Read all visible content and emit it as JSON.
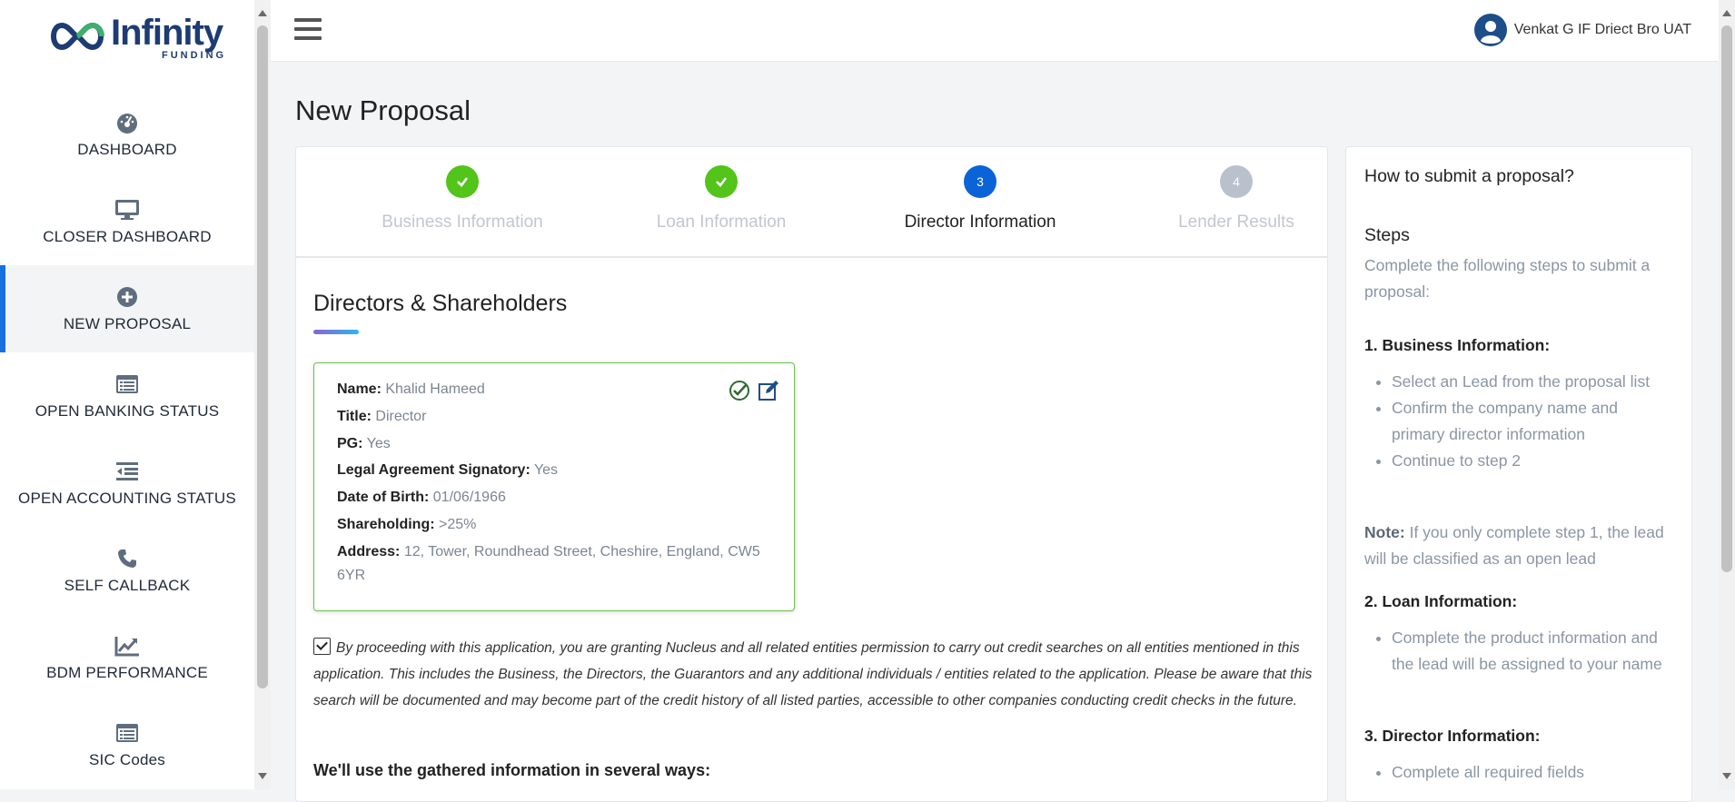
{
  "logo": {
    "brand": "Infinity",
    "sub": "FUNDING"
  },
  "sidebar": {
    "items": [
      {
        "label": "DASHBOARD",
        "icon": "dashboard-gauge-icon"
      },
      {
        "label": "CLOSER DASHBOARD",
        "icon": "monitor-icon"
      },
      {
        "label": "NEW PROPOSAL",
        "icon": "plus-circle-icon",
        "active": true
      },
      {
        "label": "OPEN BANKING STATUS",
        "icon": "list-window-icon"
      },
      {
        "label": "OPEN ACCOUNTING STATUS",
        "icon": "indent-list-icon"
      },
      {
        "label": "SELF CALLBACK",
        "icon": "phone-icon"
      },
      {
        "label": "BDM PERFORMANCE",
        "icon": "line-chart-icon"
      },
      {
        "label": "SIC Codes",
        "icon": "list-window-icon"
      }
    ]
  },
  "topbar": {
    "user_name": "Venkat G IF Driect Bro UAT"
  },
  "page": {
    "title": "New Proposal"
  },
  "stepper": {
    "steps": [
      {
        "number": "",
        "label": "Business Information",
        "state": "done"
      },
      {
        "number": "",
        "label": "Loan Information",
        "state": "done"
      },
      {
        "number": "3",
        "label": "Director Information",
        "state": "current"
      },
      {
        "number": "4",
        "label": "Lender Results",
        "state": "future"
      }
    ]
  },
  "directors": {
    "section_title": "Directors & Shareholders",
    "card": {
      "name_label": "Name:",
      "name": "Khalid Hameed",
      "title_label": "Title:",
      "title": "Director",
      "pg_label": "PG:",
      "pg": "Yes",
      "signatory_label": "Legal Agreement Signatory:",
      "signatory": "Yes",
      "dob_label": "Date of Birth:",
      "dob": "01/06/1966",
      "shareholding_label": "Shareholding:",
      "shareholding": ">25%",
      "address_label": "Address:",
      "address": "12, Tower, Roundhead Street, Cheshire, England, CW5 6YR"
    },
    "consent_text": "By proceeding with this application, you are granting Nucleus and all related entities permission to carry out credit searches on all entities mentioned in this application. This includes the Business, the Directors, the Guarantors and any additional individuals / entities related to the application. Please be aware that this search will be documented and may become part of the credit history of all listed parties, accessible to other companies conducting credit checks in the future.",
    "consent_checked": true,
    "ways_heading": "We'll use the gathered information in several ways:"
  },
  "help": {
    "title": "How to submit a proposal?",
    "steps_heading": "Steps",
    "intro": "Complete the following steps to submit a proposal:",
    "section1": "1. Business Information:",
    "section1_items": [
      "Select an Lead from the proposal list",
      "Confirm the company name and primary director information",
      "Continue to step 2"
    ],
    "note_label": "Note:",
    "note_text": " If you only complete step 1, the lead will be classified as an open lead",
    "section2": "2. Loan Information:",
    "section2_items": [
      "Complete the product information and the lead will be assigned to your name"
    ],
    "section3": "3. Director Information:",
    "section3_items": [
      "Complete all required fields"
    ]
  },
  "colors": {
    "accent": "#1a6fe0",
    "done": "#52c41a",
    "current": "#0b63d8",
    "future": "#b8c1cc",
    "brand": "#1d3b74"
  }
}
